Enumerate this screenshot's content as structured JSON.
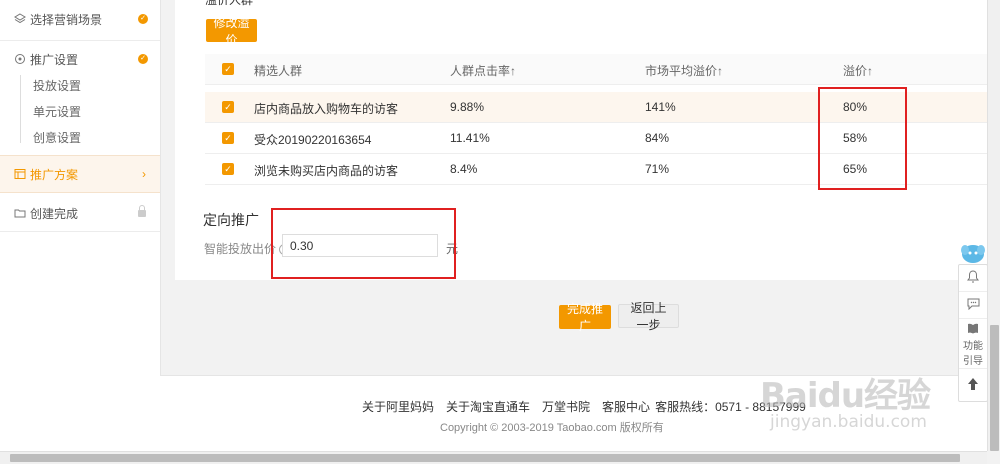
{
  "sidebar": {
    "items": [
      {
        "label": "选择营销场景",
        "icon": "layers-icon",
        "done": true
      },
      {
        "label": "推广设置",
        "icon": "target-icon",
        "done": true
      },
      {
        "label": "推广方案",
        "icon": "plan-icon",
        "active": true
      },
      {
        "label": "创建完成",
        "icon": "folder-icon",
        "locked": true
      }
    ],
    "subitems": [
      "投放设置",
      "单元设置",
      "创意设置"
    ]
  },
  "main": {
    "partial_heading": "溢价人群",
    "modify_button": "修改溢价",
    "table": {
      "headers": [
        "精选人群",
        "人群点击率↑",
        "市场平均溢价↑",
        "溢价↑"
      ],
      "rows": [
        [
          "店内商品放入购物车的访客",
          "9.88%",
          "141%",
          "80%"
        ],
        [
          "受众20190220163654",
          "11.41%",
          "84%",
          "58%"
        ],
        [
          "浏览未购买店内商品的访客",
          "8.4%",
          "71%",
          "65%"
        ]
      ]
    },
    "targeting": {
      "title": "定向推广",
      "bid_label": "智能投放出价",
      "bid_value": "0.30",
      "unit": "元"
    },
    "finish_button": "完成推广",
    "back_button": "返回上一步"
  },
  "footer": {
    "links": [
      "关于阿里妈妈",
      "关于淘宝直通车",
      "万堂书院",
      "客服中心",
      "客服热线：0571 - 88157999"
    ],
    "copyright": "Copyright © 2003-2019 Taobao.com 版权所有"
  },
  "floatbar": {
    "guide_label_1": "功能",
    "guide_label_2": "引导"
  },
  "watermark": {
    "logo": "Baidu经验",
    "url": "jingyan.baidu.com"
  },
  "colors": {
    "accent": "#f39800",
    "highlight": "#e02020"
  }
}
